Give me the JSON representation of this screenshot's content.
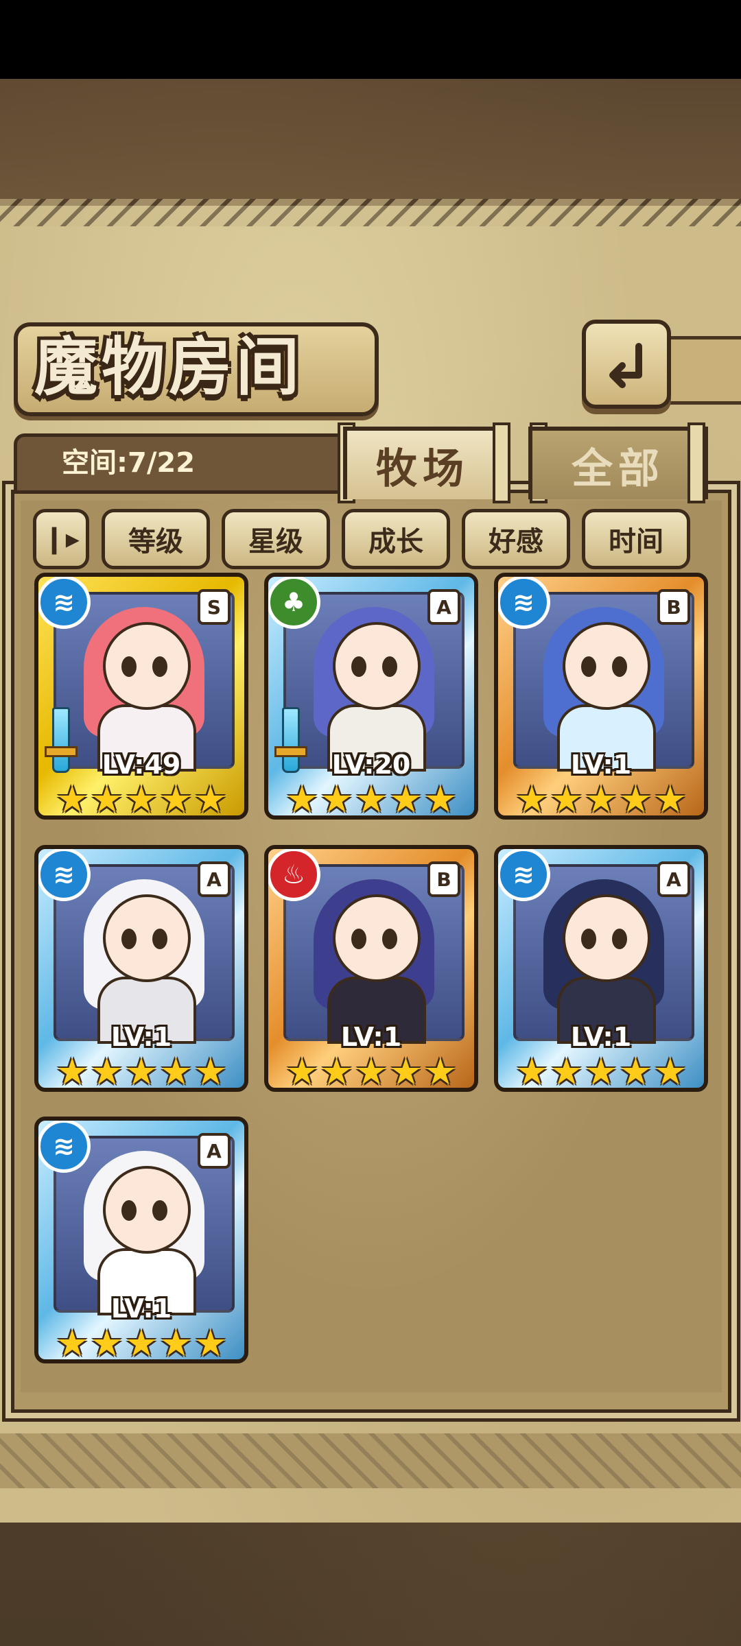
{
  "header": {
    "title": "魔物房间",
    "back_icon": "back-arrow-icon"
  },
  "capacity": {
    "text": "空间:7/22"
  },
  "tabs": [
    {
      "label": "牧场",
      "active": true
    },
    {
      "label": "全部",
      "active": false
    }
  ],
  "sort": {
    "toggle_icon": "sort-toggle-icon"
  },
  "filters": [
    "等级",
    "星级",
    "成长",
    "好感",
    "时间"
  ],
  "monsters": [
    {
      "element": "water",
      "grade": "S",
      "level": "LV:49",
      "stars": 5,
      "frame": "gold",
      "equipped": true,
      "hair": "#f0707c",
      "outfit": "#f7f0f2"
    },
    {
      "element": "wood",
      "grade": "A",
      "level": "LV:20",
      "stars": 5,
      "frame": "blue",
      "equipped": true,
      "hair": "#5d67c8",
      "outfit": "#f0eee6"
    },
    {
      "element": "water",
      "grade": "B",
      "level": "LV:1",
      "stars": 5,
      "frame": "bronze",
      "equipped": false,
      "hair": "#4e6fd0",
      "outfit": "#d9f1ff"
    },
    {
      "element": "water",
      "grade": "A",
      "level": "LV:1",
      "stars": 5,
      "frame": "blue",
      "equipped": false,
      "hair": "#f4f4f8",
      "outfit": "#e6e6ea"
    },
    {
      "element": "fire",
      "grade": "B",
      "level": "LV:1",
      "stars": 5,
      "frame": "bronze",
      "equipped": false,
      "hair": "#3d3f8e",
      "outfit": "#2e2a3a"
    },
    {
      "element": "water",
      "grade": "A",
      "level": "LV:1",
      "stars": 5,
      "frame": "blue",
      "equipped": false,
      "hair": "#27305c",
      "outfit": "#30324a"
    },
    {
      "element": "water",
      "grade": "A",
      "level": "LV:1",
      "stars": 5,
      "frame": "blue",
      "equipped": false,
      "hair": "#f5f5f8",
      "outfit": "#ffffff"
    }
  ],
  "colors": {
    "water": "#1f86d4",
    "wood": "#3e8d2d",
    "fire": "#d3252a",
    "star": "#ffcc1a"
  }
}
